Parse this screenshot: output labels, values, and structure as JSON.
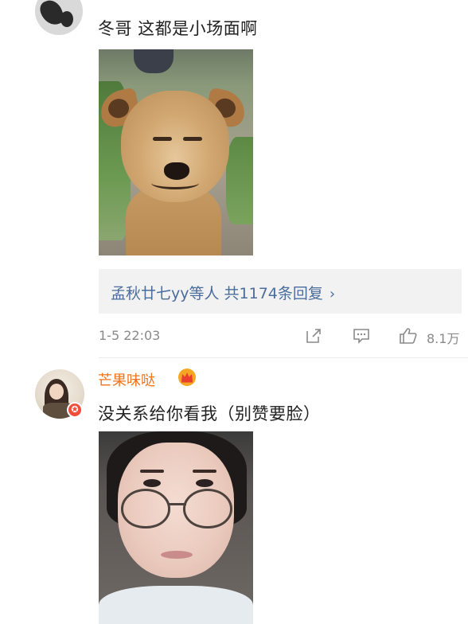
{
  "comments": [
    {
      "text": "冬哥 这都是小场面啊",
      "replies": {
        "names": "孟秋廿七yy",
        "suffix": "等人 共1174条回复",
        "chevron": "›"
      },
      "timestamp": "1-5 22:03",
      "likes": "8.1万",
      "icons": [
        "share-icon",
        "comment-icon",
        "like-icon"
      ]
    },
    {
      "username": "芒果味哒",
      "text": "没关系给你看我（别赞要脸）",
      "badge_icon": "crown-icon"
    }
  ],
  "colors": {
    "username": "#f0731a",
    "link": "#4a6d9c",
    "meta": "#8a8a8a",
    "reply_bg": "#f2f2f2"
  }
}
